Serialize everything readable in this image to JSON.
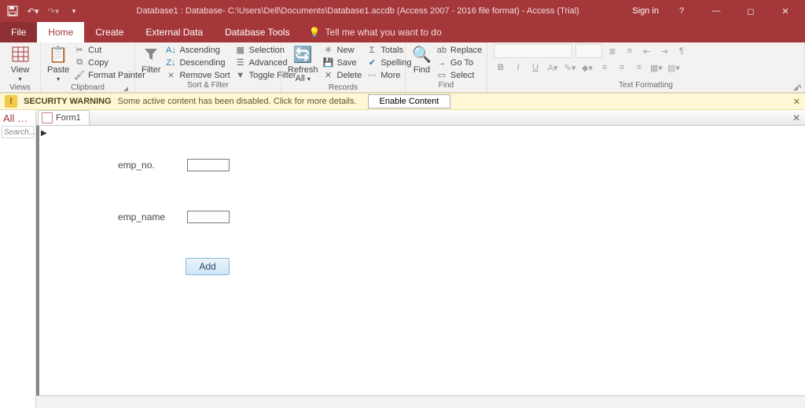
{
  "titlebar": {
    "title": "Database1 : Database- C:\\Users\\Dell\\Documents\\Database1.accdb (Access 2007 - 2016 file format) - Access (Trial)",
    "signin": "Sign in"
  },
  "tabs": {
    "file": "File",
    "home": "Home",
    "create": "Create",
    "external": "External Data",
    "tools": "Database Tools",
    "tell": "Tell me what you want to do"
  },
  "ribbon": {
    "views": {
      "view": "View",
      "group": "Views"
    },
    "clipboard": {
      "paste": "Paste",
      "cut": "Cut",
      "copy": "Copy",
      "painter": "Format Painter",
      "group": "Clipboard"
    },
    "sort": {
      "filter": "Filter",
      "asc": "Ascending",
      "desc": "Descending",
      "remove": "Remove Sort",
      "selection": "Selection",
      "advanced": "Advanced",
      "toggle": "Toggle Filter",
      "group": "Sort & Filter"
    },
    "records": {
      "refresh": "Refresh\nAll",
      "new": "New",
      "save": "Save",
      "delete": "Delete",
      "totals": "Totals",
      "spelling": "Spelling",
      "more": "More",
      "group": "Records"
    },
    "find": {
      "find": "Find",
      "replace": "Replace",
      "goto": "Go To",
      "select": "Select",
      "group": "Find"
    },
    "text": {
      "group": "Text Formatting"
    }
  },
  "security": {
    "label": "SECURITY WARNING",
    "msg": "Some active content has been disabled. Click for more details.",
    "btn": "Enable Content"
  },
  "nav": {
    "header": "All …",
    "search": "Search..."
  },
  "doc": {
    "tab": "Form1"
  },
  "form": {
    "field1_label": "emp_no.",
    "field1_value": "",
    "field2_label": "emp_name",
    "field2_value": "",
    "add": "Add"
  }
}
